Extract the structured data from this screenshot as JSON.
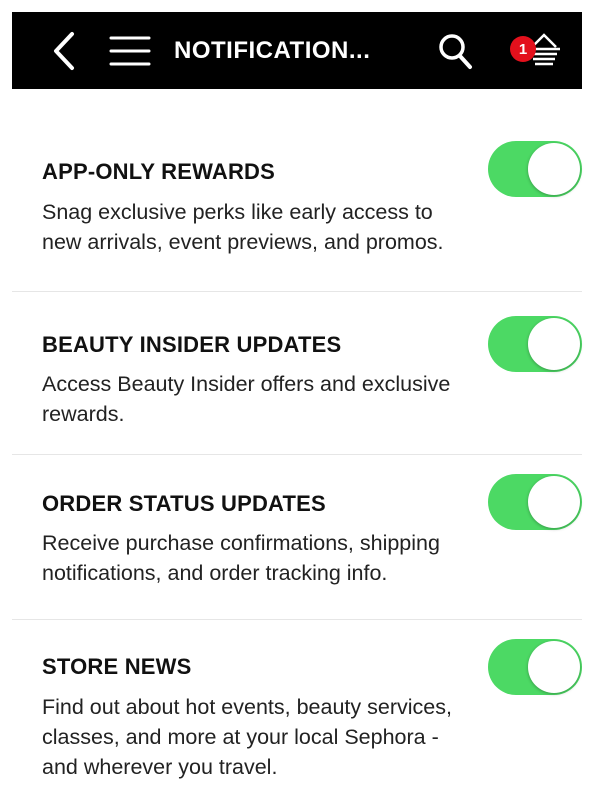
{
  "header": {
    "title": "NOTIFICATION...",
    "basket_count": "1",
    "icons": {
      "back": "chevron-left-icon",
      "menu": "hamburger-menu-icon",
      "search": "search-icon",
      "basket": "basket-icon"
    },
    "colors": {
      "background": "#000000",
      "badge": "#e3101c"
    }
  },
  "settings": [
    {
      "title": "APP-ONLY REWARDS",
      "description": "Snag exclusive perks like early access to new arrivals, event previews, and promos.",
      "enabled": true
    },
    {
      "title": "BEAUTY INSIDER UPDATES",
      "description": "Access Beauty Insider offers and exclusive rewards.",
      "enabled": true
    },
    {
      "title": "ORDER STATUS UPDATES",
      "description": "Receive purchase confirmations, shipping notifications, and order tracking info.",
      "enabled": true
    },
    {
      "title": "STORE NEWS",
      "description": "Find out about hot events, beauty services, classes, and more at your local Sephora - and wherever you travel.",
      "enabled": true
    }
  ],
  "colors": {
    "toggle_on": "#4cd964",
    "divider": "#e6e6e6"
  }
}
